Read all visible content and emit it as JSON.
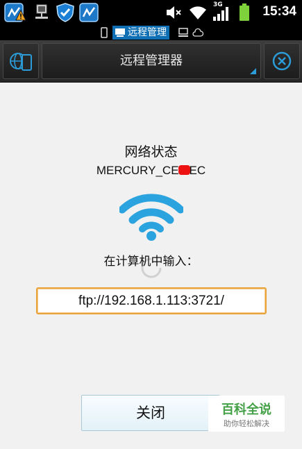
{
  "status_bar": {
    "time": "15:34",
    "network_type": "3G",
    "icons": [
      "app-icon",
      "alert-badge-icon",
      "usb-network-icon",
      "shield-icon",
      "app-icon",
      "mute-icon",
      "wifi-icon",
      "signal-icon",
      "battery-icon"
    ]
  },
  "tabs": {
    "active_label": "远程管理",
    "icons": [
      "phone-icon",
      "computer-icon",
      "network-drive-icon",
      "cloud-icon"
    ]
  },
  "toolbar": {
    "title": "远程管理器",
    "left_icon": "globe-device-icon",
    "right_icon": "close-circle-icon",
    "accent_color": "#2b9cd8"
  },
  "main": {
    "network_title": "网络状态",
    "ssid_prefix": "MERCURY_CE",
    "ssid_suffix": "EC",
    "instruction": "在计算机中输入：",
    "url": "ftp://192.168.1.113:3721/",
    "wifi_color": "#2aa3df",
    "close_label": "关闭"
  },
  "watermark": {
    "main": "百科全说",
    "sub": "助你轻松解决"
  }
}
